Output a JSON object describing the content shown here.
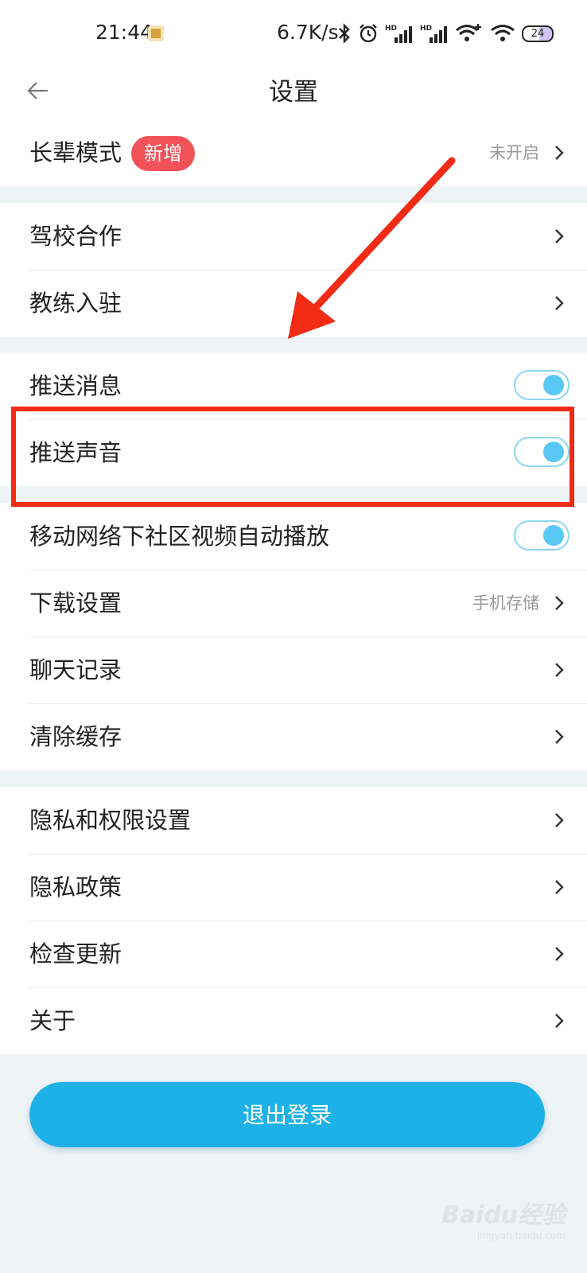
{
  "status_bar": {
    "time": "21:44",
    "network_speed": "6.7K/s",
    "battery": "24",
    "icons": [
      "bluetooth-icon",
      "alarm-icon",
      "signal-hd-icon",
      "signal-hd-icon",
      "wifi-plus-icon",
      "wifi-icon",
      "battery-icon"
    ]
  },
  "nav": {
    "title": "设置",
    "back_icon": "arrow-left-icon"
  },
  "sections": [
    {
      "items": [
        {
          "label": "长辈模式",
          "badge": "新增",
          "value": "未开启"
        }
      ]
    },
    {
      "items": [
        {
          "label": "驾校合作"
        },
        {
          "label": "教练入驻"
        }
      ]
    },
    {
      "items": [
        {
          "label": "推送消息",
          "toggle": true
        },
        {
          "label": "推送声音",
          "toggle": true
        }
      ]
    },
    {
      "items": [
        {
          "label": "移动网络下社区视频自动播放",
          "toggle": true
        },
        {
          "label": "下载设置",
          "value": "手机存储"
        },
        {
          "label": "聊天记录"
        },
        {
          "label": "清除缓存"
        }
      ]
    },
    {
      "items": [
        {
          "label": "隐私和权限设置"
        },
        {
          "label": "隐私政策"
        },
        {
          "label": "检查更新"
        },
        {
          "label": "关于"
        }
      ]
    }
  ],
  "logout_label": "退出登录",
  "watermark": {
    "text": "Baidu经验",
    "sub": "jingyan.baidu.com"
  },
  "colors": {
    "accent": "#1eb1e8",
    "toggle_on": "#5ac8f5",
    "badge": "#f2525a",
    "annotation": "#f12b14"
  }
}
